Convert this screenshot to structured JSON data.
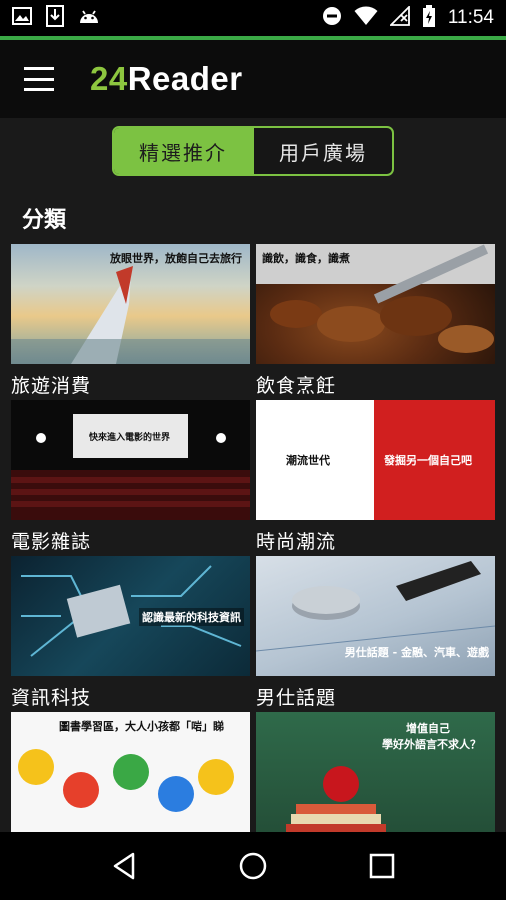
{
  "status_bar": {
    "time": "11:54",
    "left_icons": [
      "image-icon",
      "download-icon",
      "android-icon"
    ],
    "right_icons": [
      "do-not-disturb-icon",
      "wifi-icon",
      "no-signal-icon",
      "battery-charging-icon"
    ]
  },
  "app_bar": {
    "brand_number": "24",
    "brand_word": "Reader",
    "brand_number_color": "#8dc63f"
  },
  "tabs": [
    {
      "label": "精選推介",
      "active": true
    },
    {
      "label": "用戶廣場",
      "active": false
    }
  ],
  "accent_color": "#7cc242",
  "section": {
    "title": "分類"
  },
  "categories": [
    {
      "label": "旅遊消費",
      "overlay": "放眼世界，放飽自己去旅行"
    },
    {
      "label": "飲食烹飪",
      "overlay": "識飲，識食，識煮"
    },
    {
      "label": "電影雜誌",
      "overlay": "快來進入電影的世界"
    },
    {
      "label": "時尚潮流",
      "overlay_left": "潮流世代",
      "overlay_right": "發掘另一個自己吧"
    },
    {
      "label": "資訊科技",
      "overlay": "認識最新的科技資訊"
    },
    {
      "label": "男仕話題",
      "overlay": "男仕話題 - 金融、汽車、遊戲"
    },
    {
      "label": "",
      "overlay": "圖書學習區，大人小孩都「啱」睇"
    },
    {
      "label": "",
      "overlay_line1": "增值自己",
      "overlay_line2": "學好外語言不求人？"
    }
  ],
  "nav_bar": {
    "icons": [
      "back-icon",
      "home-icon",
      "recents-icon"
    ]
  }
}
